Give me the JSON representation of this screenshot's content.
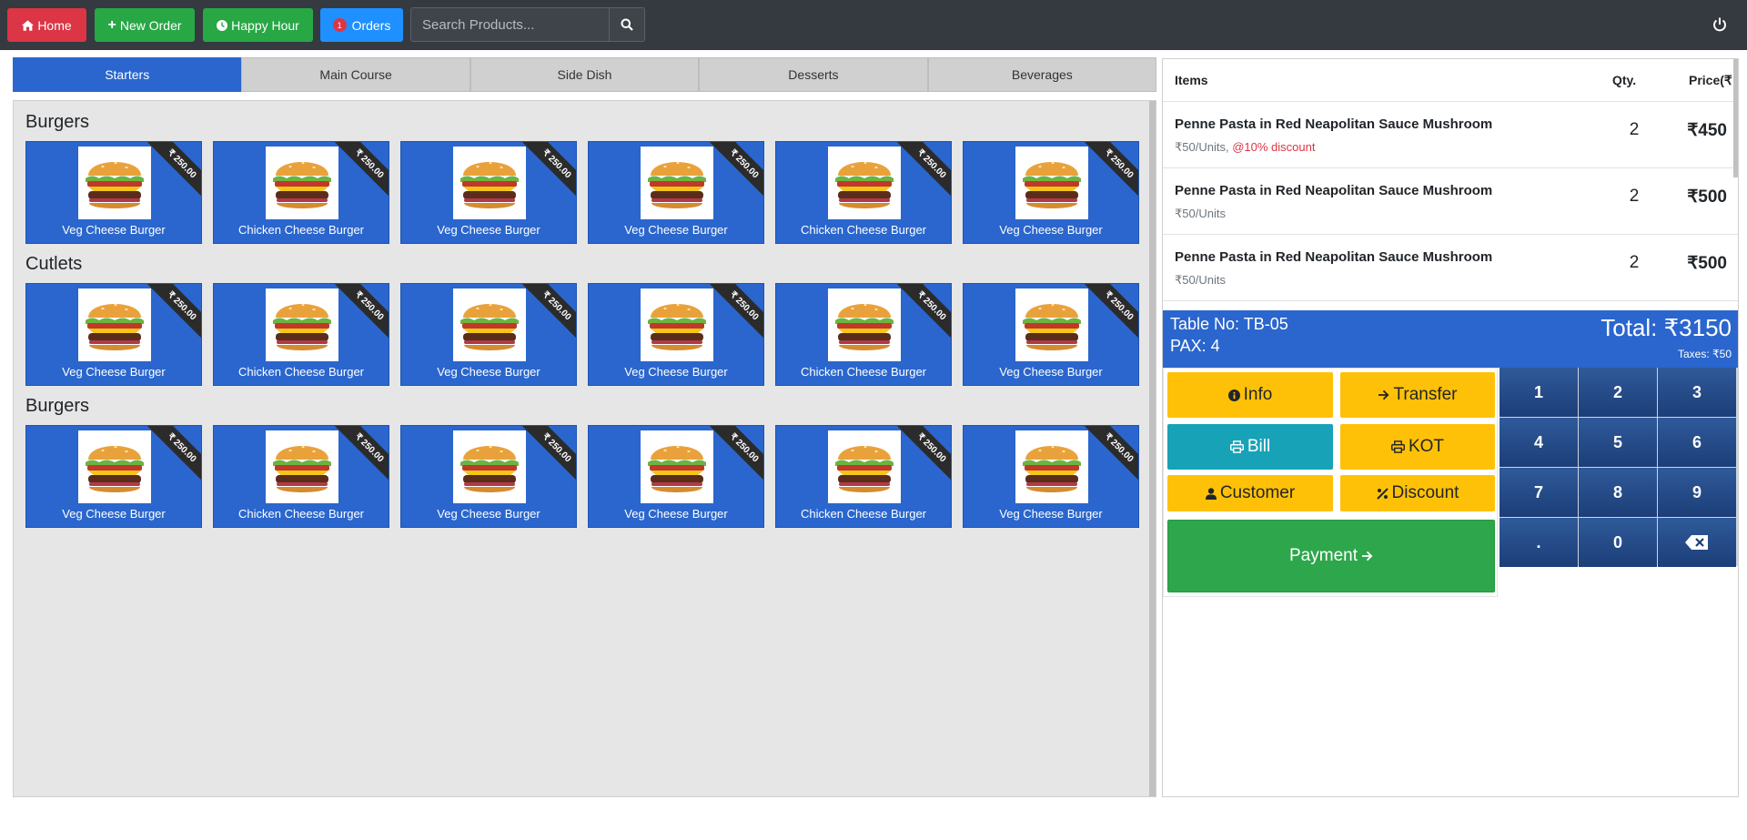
{
  "nav": {
    "home": "Home",
    "new_order": "New Order",
    "happy_hour": "Happy Hour",
    "orders": "Orders",
    "orders_badge": "1",
    "search_placeholder": "Search Products..."
  },
  "categories": [
    "Starters",
    "Main Course",
    "Side Dish",
    "Desserts",
    "Beverages"
  ],
  "sections": [
    {
      "title": "Burgers",
      "items": [
        {
          "name": "Veg Cheese Burger",
          "price": "₹ 250.00"
        },
        {
          "name": "Chicken Cheese Burger",
          "price": "₹ 250.00"
        },
        {
          "name": "Veg Cheese Burger",
          "price": "₹ 250.00"
        },
        {
          "name": "Veg Cheese Burger",
          "price": "₹ 250.00"
        },
        {
          "name": "Chicken Cheese Burger",
          "price": "₹ 250.00"
        },
        {
          "name": "Veg Cheese Burger",
          "price": "₹ 250.00"
        }
      ]
    },
    {
      "title": "Cutlets",
      "items": [
        {
          "name": "Veg Cheese Burger",
          "price": "₹ 250.00"
        },
        {
          "name": "Chicken Cheese Burger",
          "price": "₹ 250.00"
        },
        {
          "name": "Veg Cheese Burger",
          "price": "₹ 250.00"
        },
        {
          "name": "Veg Cheese Burger",
          "price": "₹ 250.00"
        },
        {
          "name": "Chicken Cheese Burger",
          "price": "₹ 250.00"
        },
        {
          "name": "Veg Cheese Burger",
          "price": "₹ 250.00"
        }
      ]
    },
    {
      "title": "Burgers",
      "items": [
        {
          "name": "Veg Cheese Burger",
          "price": "₹ 250.00"
        },
        {
          "name": "Chicken Cheese Burger",
          "price": "₹ 250.00"
        },
        {
          "name": "Veg Cheese Burger",
          "price": "₹ 250.00"
        },
        {
          "name": "Veg Cheese Burger",
          "price": "₹ 250.00"
        },
        {
          "name": "Chicken Cheese Burger",
          "price": "₹ 250.00"
        },
        {
          "name": "Veg Cheese Burger",
          "price": "₹ 250.00"
        }
      ]
    }
  ],
  "order": {
    "headers": {
      "items": "Items",
      "qty": "Qty.",
      "price": "Price(₹"
    },
    "lines": [
      {
        "name": "Penne Pasta in Red Neapolitan Sauce Mushroom",
        "unit": "₹50/Units",
        "discount": "@10% discount",
        "qty": "2",
        "price": "₹450"
      },
      {
        "name": "Penne Pasta in Red Neapolitan Sauce Mushroom",
        "unit": "₹50/Units",
        "discount": "",
        "qty": "2",
        "price": "₹500"
      },
      {
        "name": "Penne Pasta in Red Neapolitan Sauce Mushroom",
        "unit": "₹50/Units",
        "discount": "",
        "qty": "2",
        "price": "₹500"
      }
    ],
    "table_no": "Table No: TB-05",
    "pax": "PAX: 4",
    "total": "Total: ₹3150",
    "taxes": "Taxes: ₹50"
  },
  "actions": {
    "info": "Info",
    "transfer": "Transfer",
    "bill": "Bill",
    "kot": "KOT",
    "customer": "Customer",
    "discount": "Discount",
    "payment": "Payment"
  },
  "numpad": [
    "1",
    "2",
    "3",
    "4",
    "5",
    "6",
    "7",
    "8",
    "9",
    ".",
    "0"
  ],
  "colors": {
    "primary": "#2a66cd",
    "danger": "#dc3545",
    "success": "#28a745",
    "warning": "#ffc107",
    "info": "#17a2b8",
    "navbar": "#343a40"
  }
}
